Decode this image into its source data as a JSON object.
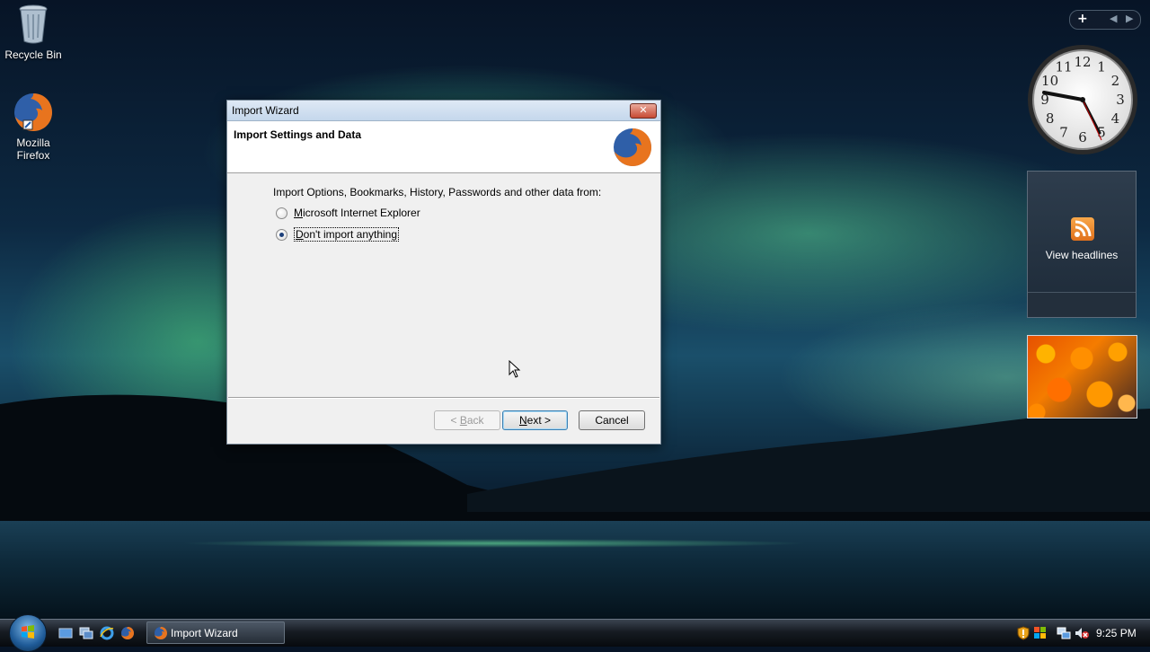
{
  "desktop": {
    "icons": [
      {
        "label": "Recycle Bin"
      },
      {
        "label": "Mozilla Firefox"
      }
    ]
  },
  "window": {
    "title": "Import Wizard",
    "close_glyph": "✕",
    "heading": "Import Settings and Data",
    "prompt": "Import Options, Bookmarks, History, Passwords and other data from:",
    "options": [
      {
        "prefix": "",
        "accel": "M",
        "rest": "icrosoft Internet Explorer",
        "checked": false
      },
      {
        "prefix": "",
        "accel": "D",
        "rest": "on't import anything",
        "checked": true
      }
    ],
    "buttons": {
      "back_prefix": "< ",
      "back_accel": "B",
      "back_rest": "ack",
      "next_accel": "N",
      "next_rest": "ext >",
      "cancel": "Cancel"
    }
  },
  "sidebar": {
    "plus": "+",
    "feed_label": "View headlines",
    "clock_numbers": [
      "12",
      "1",
      "2",
      "3",
      "4",
      "5",
      "6",
      "7",
      "8",
      "9",
      "10",
      "11"
    ]
  },
  "taskbar": {
    "task_label": "Import Wizard",
    "time": "9:25 PM"
  },
  "icons": [
    "recycle-bin-icon",
    "firefox-icon",
    "rss-icon",
    "windows-flag-icon",
    "show-desktop-icon",
    "switch-windows-icon",
    "ie-icon",
    "shield-icon",
    "network-icon",
    "volume-muted-icon"
  ]
}
